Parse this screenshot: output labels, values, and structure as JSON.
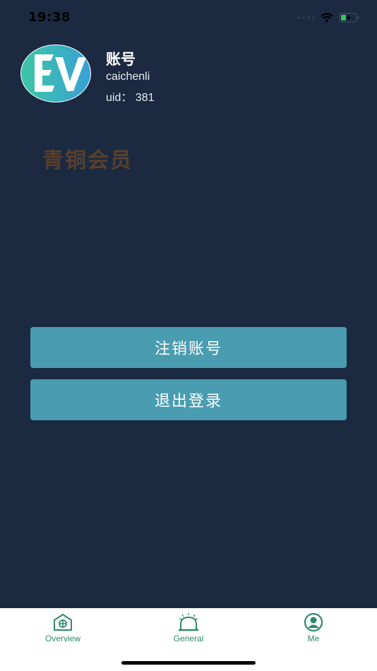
{
  "status_bar": {
    "time": "19:38"
  },
  "profile": {
    "avatar_text": "EV",
    "title": "账号",
    "username": "caichenli",
    "uid": "uid： 381",
    "member_level": "青铜会员"
  },
  "actions": {
    "cancel_account": "注销账号",
    "logout": "退出登录"
  },
  "tabs": [
    {
      "label": "Overview",
      "icon": "house-icon"
    },
    {
      "label": "General",
      "icon": "alarm-bell-icon"
    },
    {
      "label": "Me",
      "icon": "user-circle-icon"
    }
  ],
  "colors": {
    "background": "#1b2a41",
    "button": "#4a9cb0",
    "member_level": "#5a3f2b",
    "tab_accent": "#2f8a6a"
  }
}
